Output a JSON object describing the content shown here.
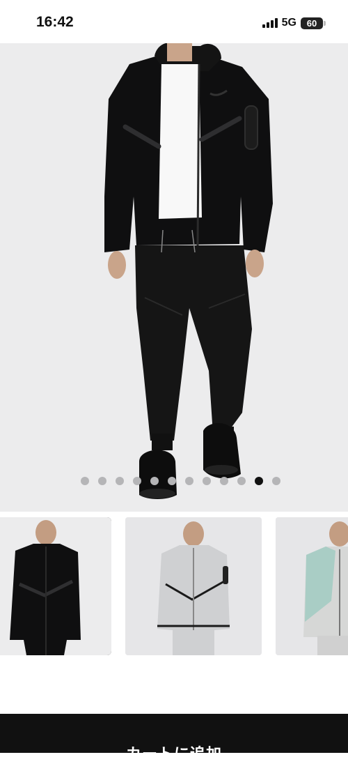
{
  "status_bar": {
    "time": "16:42",
    "network": "5G",
    "battery": "60"
  },
  "gallery": {
    "dot_count": 12,
    "active_dot_index": 10
  },
  "thumbnails": [
    {
      "color": "black",
      "selected": true
    },
    {
      "color": "light-grey",
      "selected": false
    },
    {
      "color": "mint-grey",
      "selected": false
    }
  ],
  "cart_button": {
    "label": "カートに追加"
  },
  "colors": {
    "hero_background": "#ececed",
    "button_background": "#111111",
    "active_dot": "#111111",
    "inactive_dot": "#b5b5b7"
  }
}
